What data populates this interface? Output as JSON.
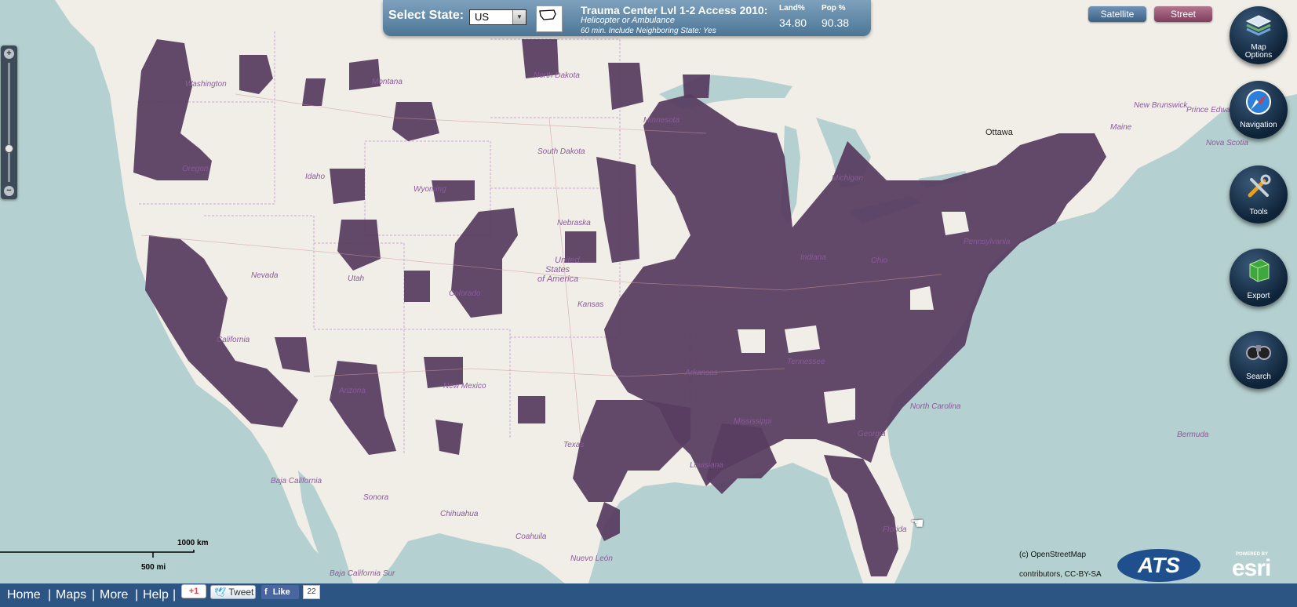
{
  "header": {
    "select_label": "Select State:",
    "state_value": "US",
    "trauma_title": "Trauma Center Lvl 1-2 Access 2010:",
    "subtitle_line1": "Helicopter or Ambulance",
    "subtitle_line2": "60 min. Include Neighboring State: Yes",
    "land_label": "Land%",
    "pop_label": "Pop %",
    "land_value": "34.80",
    "pop_value": "90.38"
  },
  "basemap": {
    "satellite_label": "Satellite",
    "street_label": "Street"
  },
  "tools": {
    "map_options_label_1": "Map",
    "map_options_label_2": "Options",
    "navigation_label": "Navigation",
    "tools_label": "Tools",
    "export_label": "Export",
    "search_label": "Search"
  },
  "map_labels": {
    "washington": "Washington",
    "montana": "Montana",
    "north_dakota": "North Dakota",
    "south_dakota": "South Dakota",
    "oregon": "Oregon",
    "idaho": "Idaho",
    "wyoming": "Wyoming",
    "nebraska": "Nebraska",
    "nevada": "Nevada",
    "utah": "Utah",
    "colorado": "Colorado",
    "kansas": "Kansas",
    "california": "California",
    "arizona": "Arizona",
    "new_mexico": "New Mexico",
    "texas": "Texas",
    "arkansas": "Arkansas",
    "louisiana": "Louisiana",
    "mississippi": "Mississippi",
    "tennessee": "Tennessee",
    "georgia": "Georgia",
    "north_carolina": "North Carolina",
    "florida": "Florida",
    "indiana": "Indiana",
    "minnesota": "Minnesota",
    "michigan": "Michigan",
    "pennsylvania": "Pennsylvania",
    "ohio": "Ohio",
    "maine": "Maine",
    "new_brunswick": "New Brunswick",
    "prince_edward": "Prince Edward I.",
    "nova_scotia": "Nova Scotia",
    "united_states_1": "United",
    "united_states_2": "States",
    "united_states_3": "of America",
    "baja_california": "Baja California",
    "baja_california_sur": "Baja California Sur",
    "sonora": "Sonora",
    "chihuahua": "Chihuahua",
    "coahuila": "Coahuila",
    "nuevo_leon": "Nuevo León",
    "bermuda": "Bermuda",
    "ottawa": "Ottawa"
  },
  "scale": {
    "km_label": "1000 km",
    "mi_label": "500 mi"
  },
  "attribution": {
    "line1": "(c) OpenStreetMap",
    "line2": "contributors, CC-BY-SA",
    "ats": "ATS",
    "esri_powered": "POWERED BY",
    "esri": "esri"
  },
  "footer": {
    "home": "Home",
    "maps": "Maps",
    "more": "More",
    "help": "Help",
    "separator": "|",
    "gplus": "+1",
    "tweet": "Tweet",
    "like": "Like",
    "like_count": "22"
  },
  "colors": {
    "coverage_fill": "#5a3e62",
    "land": "#f1eee8",
    "water": "#b5d0d0",
    "footer_bar": "#2d5584"
  }
}
